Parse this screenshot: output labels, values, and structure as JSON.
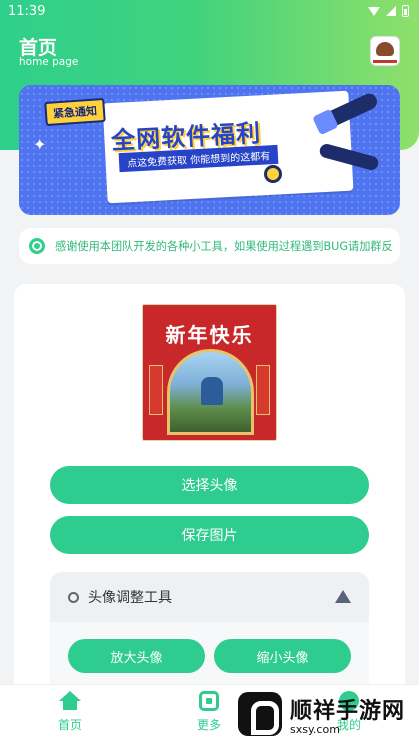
{
  "status_bar": {
    "time": "11:39"
  },
  "header": {
    "title": "首页",
    "subtitle": "home page"
  },
  "banner": {
    "tag": "紧急通知",
    "headline": "全网软件福利",
    "subline": "点这免费获取 你能想到的这都有"
  },
  "notice": {
    "text": "感谢使用本团队开发的各种小工具，如果使用过程遇到BUG请加群反"
  },
  "photo": {
    "title": "新年快乐"
  },
  "buttons": {
    "select_avatar": "选择头像",
    "save_image": "保存图片"
  },
  "tool_panel": {
    "title": "头像调整工具",
    "enlarge": "放大头像",
    "shrink": "缩小头像"
  },
  "tabbar": {
    "home": "首页",
    "more": "更多",
    "me": "我的"
  },
  "watermark": {
    "name": "顺祥手游网",
    "url": "sxsy.com"
  },
  "colors": {
    "primary": "#2ecc8f",
    "banner_blue": "#4f74f0"
  }
}
